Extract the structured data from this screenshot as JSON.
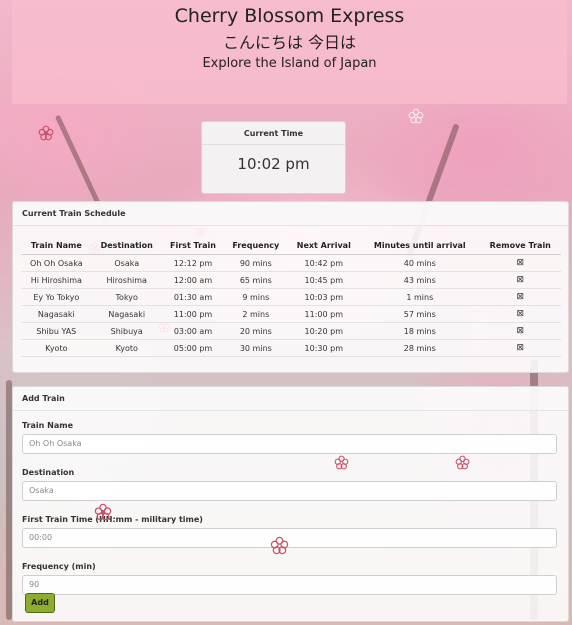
{
  "header": {
    "title": "Cherry Blossom Express",
    "subtitle_jp": "こんにちは 今日は",
    "tagline": "Explore the Island of Japan"
  },
  "clock": {
    "label": "Current Time",
    "value": "10:02 pm"
  },
  "schedule": {
    "title": "Current Train Schedule",
    "columns": [
      "Train Name",
      "Destination",
      "First Train",
      "Frequency",
      "Next Arrival",
      "Minutes until arrival",
      "Remove Train"
    ],
    "rows": [
      {
        "name": "Oh Oh Osaka",
        "destination": "Osaka",
        "first": "12:12 pm",
        "frequency": "90 mins",
        "next": "10:42 pm",
        "minutes": "40 mins",
        "remove": "⊠"
      },
      {
        "name": "Hi Hiroshima",
        "destination": "Hiroshima",
        "first": "12:00 am",
        "frequency": "65 mins",
        "next": "10:45 pm",
        "minutes": "43 mins",
        "remove": "⊠"
      },
      {
        "name": "Ey Yo Tokyo",
        "destination": "Tokyo",
        "first": "01:30 am",
        "frequency": "9 mins",
        "next": "10:03 pm",
        "minutes": "1 mins",
        "remove": "⊠"
      },
      {
        "name": "Nagasaki",
        "destination": "Nagasaki",
        "first": "11:00 pm",
        "frequency": "2 mins",
        "next": "11:00 pm",
        "minutes": "57 mins",
        "remove": "⊠"
      },
      {
        "name": "Shibu YAS",
        "destination": "Shibuya",
        "first": "03:00 am",
        "frequency": "20 mins",
        "next": "10:20 pm",
        "minutes": "18 mins",
        "remove": "⊠"
      },
      {
        "name": "Kyoto",
        "destination": "Kyoto",
        "first": "05:00 pm",
        "frequency": "30 mins",
        "next": "10:30 pm",
        "minutes": "28 mins",
        "remove": "⊠"
      }
    ]
  },
  "add_train": {
    "title": "Add Train",
    "name_label": "Train Name",
    "name_placeholder": "Oh Oh Osaka",
    "destination_label": "Destination",
    "destination_placeholder": "Osaka",
    "first_label": "First Train Time (HH:mm - military time)",
    "first_placeholder": "00:00",
    "frequency_label": "Frequency (min)",
    "frequency_placeholder": "90",
    "button_label": "Add"
  },
  "colors": {
    "header_bg": "#f8becd",
    "add_button": "#8dad31",
    "petal": "#c8506a"
  },
  "icons": {
    "remove": "remove-x-box-icon",
    "decor": "cherry-blossom-icon"
  }
}
